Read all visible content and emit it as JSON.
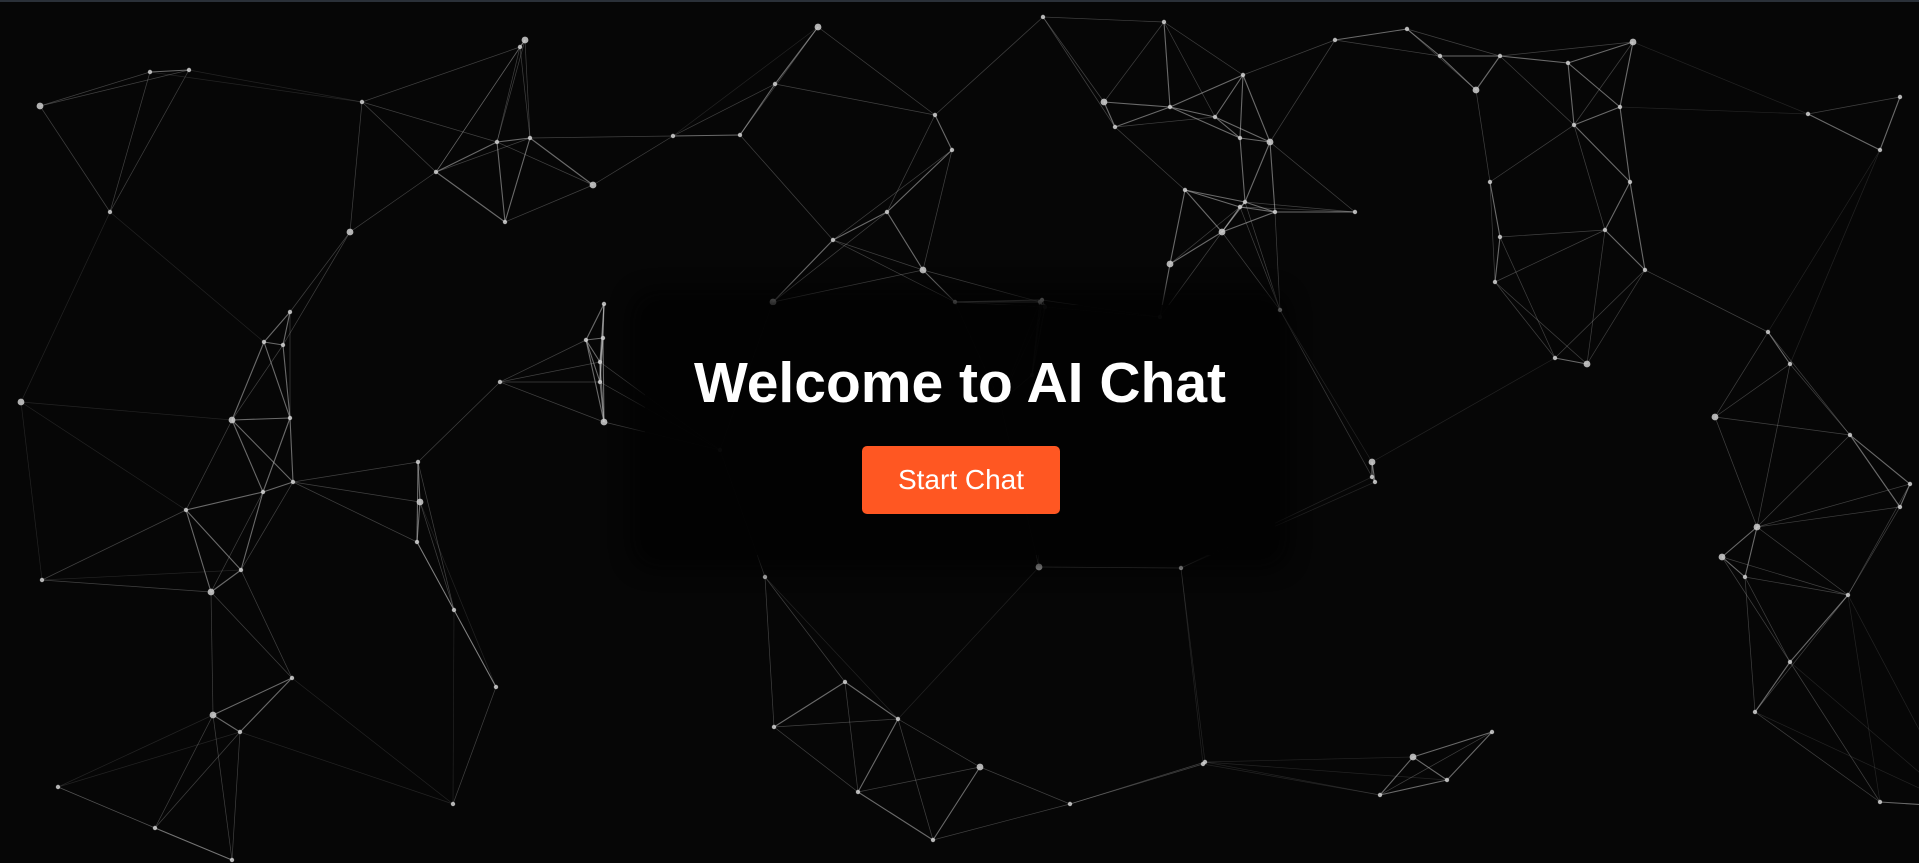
{
  "hero": {
    "title": "Welcome to AI Chat",
    "start_button_label": "Start Chat"
  },
  "colors": {
    "background": "#060606",
    "accent": "#ff5722",
    "title_text": "#ffffff",
    "network_lines": "#bdbdbd",
    "network_nodes": "#d0d0d0"
  }
}
